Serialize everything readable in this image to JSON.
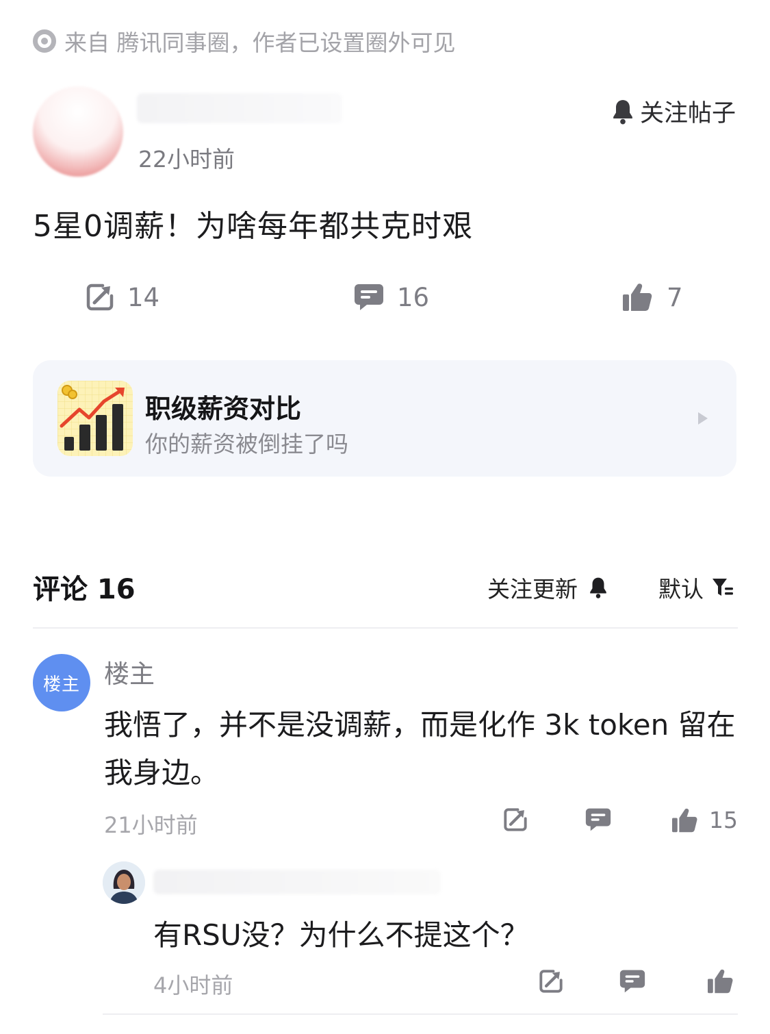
{
  "source": {
    "icon": "source-circle-icon",
    "text": "来自 腾讯同事圈，作者已设置圈外可见"
  },
  "post": {
    "time": "22小时前",
    "follow_label": "关注帖子",
    "title": "5星0调薪！为啥每年都共克时艰",
    "stats": {
      "shares": "14",
      "comments": "16",
      "likes": "7"
    }
  },
  "promo": {
    "title": "职级薪资对比",
    "subtitle": "你的薪资被倒挂了吗"
  },
  "comments_section": {
    "header": "评论 16",
    "follow_updates": "关注更新",
    "sort": "默认"
  },
  "comments": [
    {
      "badge": "楼主",
      "author": "楼主",
      "text": "我悟了，并不是没调薪，而是化作 3k token 留在我身边。",
      "time": "21小时前",
      "likes": "15",
      "reply": {
        "text": "有RSU没？为什么不提这个？",
        "time": "4小时前"
      }
    }
  ],
  "colors": {
    "accent_blue": "#5f8ff0",
    "icon_gray": "#7d7d84",
    "card_bg": "#f4f6fb"
  }
}
